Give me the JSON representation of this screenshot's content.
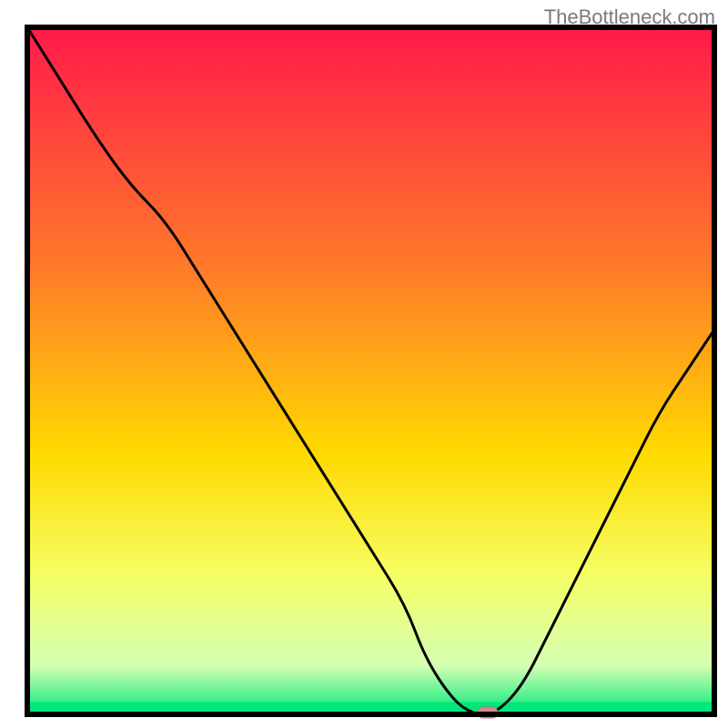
{
  "watermark": "TheBottleneck.com",
  "chart_data": {
    "type": "line",
    "title": "",
    "xlabel": "",
    "ylabel": "",
    "xlim": [
      0,
      100
    ],
    "ylim": [
      0,
      100
    ],
    "x": [
      0,
      5,
      10,
      15,
      20,
      25,
      30,
      35,
      40,
      45,
      50,
      55,
      58,
      62,
      65,
      68,
      72,
      76,
      80,
      84,
      88,
      92,
      96,
      100
    ],
    "values": [
      100,
      92,
      84,
      77,
      72,
      64,
      56,
      48,
      40,
      32,
      24,
      16,
      8,
      2,
      0,
      0,
      4,
      12,
      20,
      28,
      36,
      44,
      50,
      56
    ],
    "marker_point": {
      "x": 67,
      "y": 0
    },
    "gradient_colors": {
      "top": "#ff1a4a",
      "mid1": "#ff7a2a",
      "mid2": "#ffd900",
      "mid3": "#f5ff66",
      "bottom_band": "#d4ffb3",
      "bottom": "#00e87a"
    },
    "border_color": "#000000",
    "line_color": "#000000",
    "marker_fill": "#d98b8b",
    "marker_stroke": "#c77070"
  }
}
